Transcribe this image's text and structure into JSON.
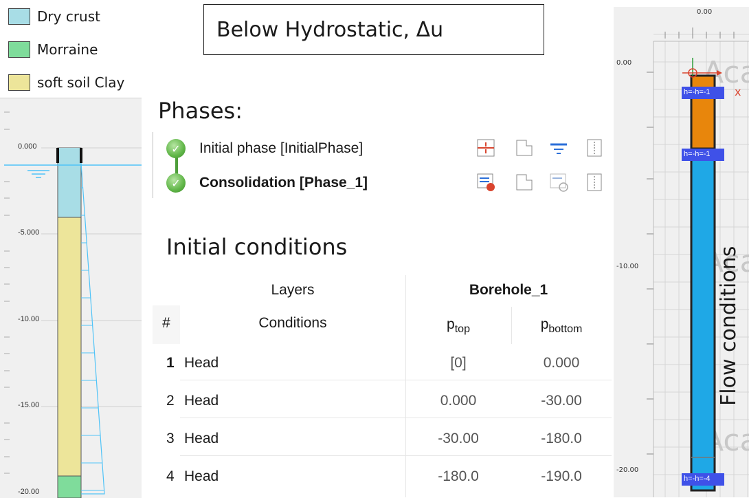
{
  "legend": {
    "items": [
      {
        "label": "Dry crust",
        "color": "#a8dde6"
      },
      {
        "label": "Morraine",
        "color": "#7fdc9b"
      },
      {
        "label": "soft soil Clay",
        "color": "#ede59a"
      }
    ]
  },
  "title_box": "Below Hydrostatic, Δu",
  "phases": {
    "heading": "Phases:",
    "items": [
      {
        "label": "Initial phase [InitialPhase]",
        "bold": false
      },
      {
        "label": "Consolidation [Phase_1]",
        "bold": true
      }
    ]
  },
  "initial_conditions": {
    "heading": "Initial conditions",
    "headers": {
      "layers": "Layers",
      "borehole": "Borehole_1",
      "hash": "#",
      "conditions": "Conditions",
      "p_top_main": "p",
      "p_top_sub": "top",
      "p_bottom_main": "p",
      "p_bottom_sub": "bottom"
    },
    "rows": [
      {
        "num": "1",
        "condition": "Head",
        "p_top": "[0]",
        "p_bottom": "0.000"
      },
      {
        "num": "2",
        "condition": "Head",
        "p_top": "0.000",
        "p_bottom": "-30.00"
      },
      {
        "num": "3",
        "condition": "Head",
        "p_top": "-30.00",
        "p_bottom": "-180.0"
      },
      {
        "num": "4",
        "condition": "Head",
        "p_top": "-180.0",
        "p_bottom": "-190.0"
      }
    ]
  },
  "left_profile": {
    "ticks": [
      "0.000",
      "-5.000",
      "-10.00",
      "-15.00",
      "-20.00"
    ]
  },
  "right_profile": {
    "top_tick": "0.00",
    "ticks": [
      "0.00",
      "-10.00",
      "-20.00"
    ],
    "axis_label": "x",
    "flow_label": "Flow conditions",
    "watermark": "Aca",
    "head_tags": [
      "h=-h=-1",
      "h=-h=-1",
      "h=-h=-4"
    ]
  },
  "colors": {
    "water_line": "#4fc3f7",
    "column_blue": "#1fa8e6",
    "column_orange": "#e8860c",
    "tag_blue": "#3f51e8"
  }
}
